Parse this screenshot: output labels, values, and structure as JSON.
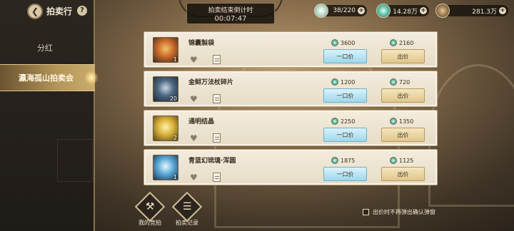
{
  "header": {
    "title": "拍卖行",
    "help_icon": "?",
    "back_icon": "chevron-left"
  },
  "sidebar": {
    "items": [
      {
        "label": "分红",
        "active": false
      },
      {
        "label": "瀛海孤山拍卖会",
        "active": true
      }
    ]
  },
  "timer": {
    "label": "拍卖结束倒计时",
    "value": "00:07:47"
  },
  "currencies": [
    {
      "icon": "flower-icon",
      "value": "38/220"
    },
    {
      "icon": "gem-icon",
      "value": "14.28万"
    },
    {
      "icon": "token-icon",
      "value": "281.3万"
    }
  ],
  "listings": [
    {
      "name": "锦囊製袋",
      "qty": "1",
      "buyout_price": "3600",
      "bid_price": "2160",
      "buyout_label": "一口价",
      "bid_label": "出价",
      "thumb_color": "#d98a3a"
    },
    {
      "name": "金鲟万法杖碎片",
      "qty": "20",
      "buyout_price": "1200",
      "bid_price": "720",
      "buyout_label": "一口价",
      "bid_label": "出价",
      "thumb_color": "#4a6a8a"
    },
    {
      "name": "通明结晶",
      "qty": "2",
      "buyout_price": "2250",
      "bid_price": "1350",
      "buyout_label": "一口价",
      "bid_label": "出价",
      "thumb_color": "#c9a63a"
    },
    {
      "name": "青蓝幻琉璃·浑圆",
      "qty": "1",
      "buyout_price": "1875",
      "bid_price": "1125",
      "buyout_label": "一口价",
      "bid_label": "出价",
      "thumb_color": "#5aa0c8"
    }
  ],
  "bottom": {
    "my_bids_label": "我的竞拍",
    "records_label": "拍卖记录",
    "confirm_text": "出价时不再弹出确认弹窗"
  }
}
